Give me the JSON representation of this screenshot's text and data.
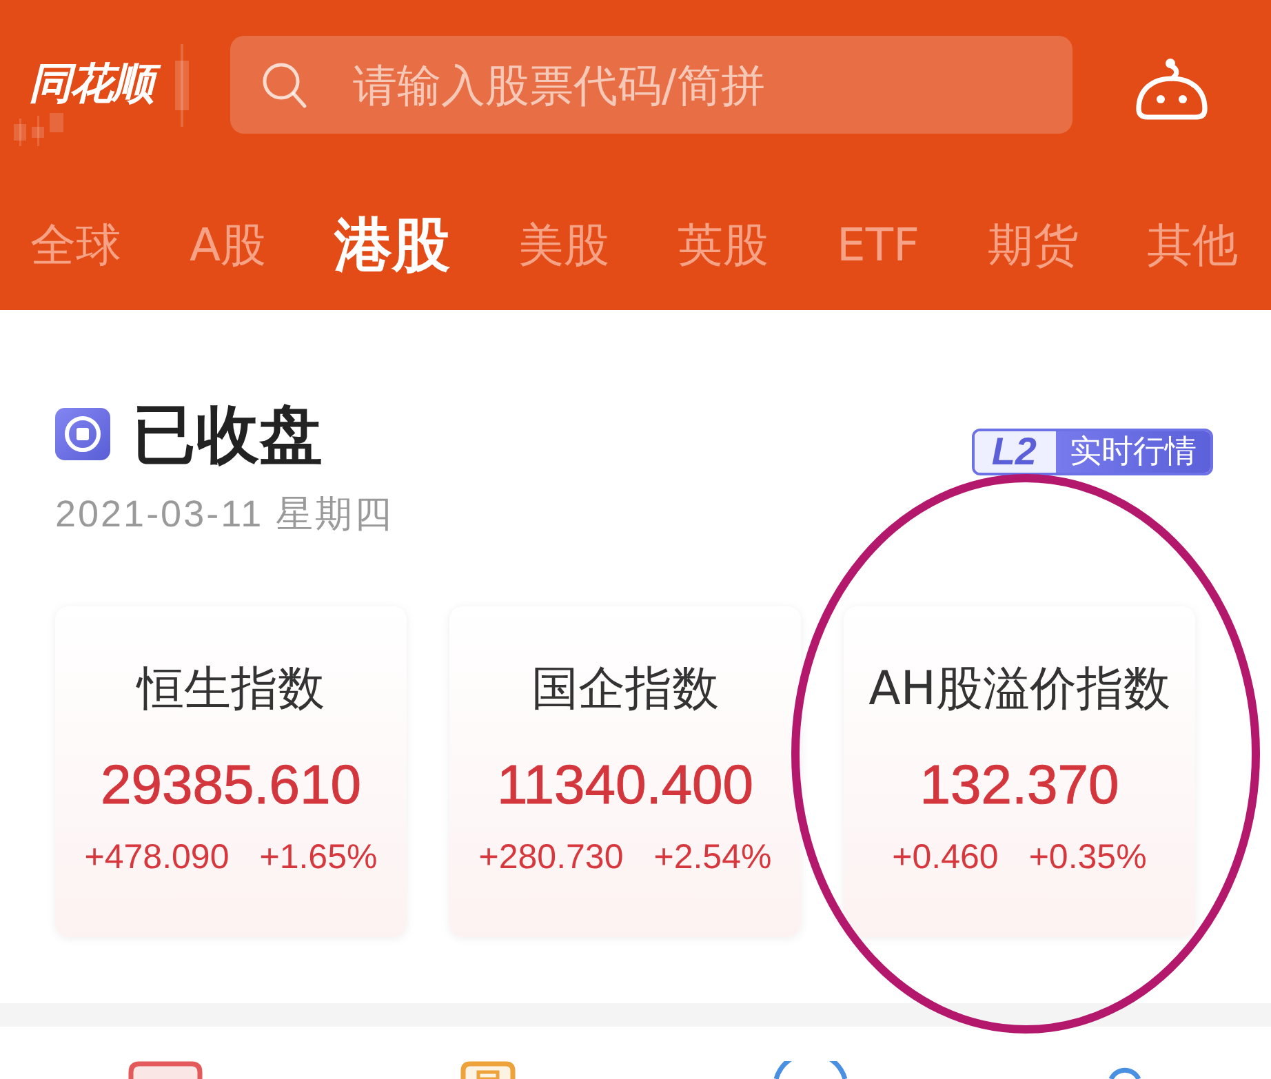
{
  "header": {
    "logo": "同花顺",
    "search": {
      "placeholder": "请输入股票代码/简拼"
    }
  },
  "tabs": [
    {
      "label": "全球",
      "selected": false
    },
    {
      "label": "A股",
      "selected": false
    },
    {
      "label": "港股",
      "selected": true
    },
    {
      "label": "美股",
      "selected": false
    },
    {
      "label": "英股",
      "selected": false
    },
    {
      "label": "ETF",
      "selected": false
    },
    {
      "label": "期货",
      "selected": false
    },
    {
      "label": "其他",
      "selected": false
    }
  ],
  "market_status": {
    "title": "已收盘",
    "date": "2021-03-11 星期四",
    "badge": {
      "tag": "L2",
      "label": "实时行情"
    }
  },
  "index_cards": [
    {
      "name": "恒生指数",
      "value": "29385.610",
      "change": "+478.090",
      "change_percent": "+1.65%",
      "circled": false
    },
    {
      "name": "国企指数",
      "value": "11340.400",
      "change": "+280.730",
      "change_percent": "+2.54%",
      "circled": false
    },
    {
      "name": "AH股溢价指数",
      "value": "132.370",
      "change": "+0.460",
      "change_percent": "+0.35%",
      "circled": true
    }
  ]
}
